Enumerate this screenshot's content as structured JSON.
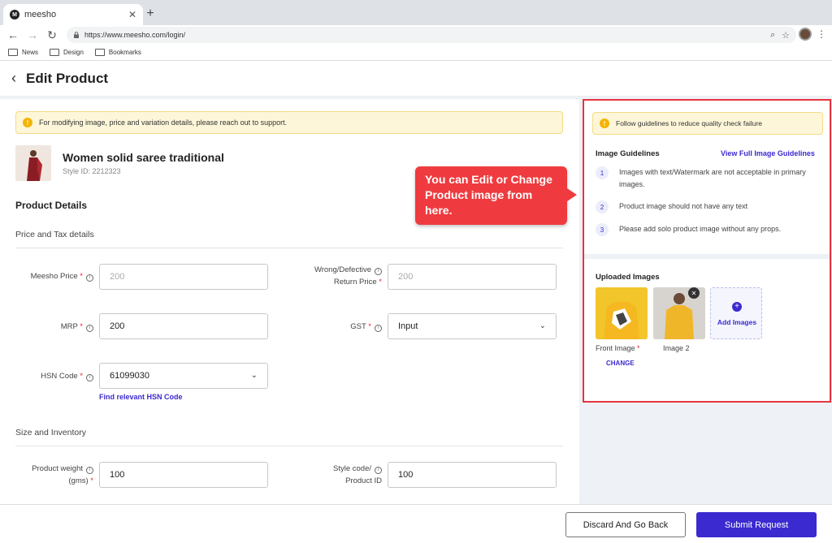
{
  "browser": {
    "tab_title": "meesho",
    "favicon_letter": "M",
    "url": "https://www.meesho.com/login/",
    "bookmarks": [
      "News",
      "Design",
      "Bookmarks"
    ]
  },
  "header": {
    "title": "Edit Product"
  },
  "form": {
    "notice": "For modifying image, price and variation details, please reach out to support.",
    "product_name": "Women solid saree traditional",
    "style_id": "Style ID: 2212323",
    "section_title": "Product Details",
    "price_tax_title": "Price and Tax details",
    "meesho_price_label": "Meesho Price",
    "meesho_price_value": "200",
    "return_price_label_1": "Wrong/Defective",
    "return_price_label_2": "Return Price",
    "return_price_value": "200",
    "mrp_label": "MRP",
    "mrp_value": "200",
    "gst_label": "GST",
    "gst_value": "Input",
    "hsn_label": "HSN Code",
    "hsn_value": "61099030",
    "hsn_link": "Find relevant HSN Code",
    "size_inventory_title": "Size and Inventory",
    "weight_label_1": "Product weight",
    "weight_label_2": "(gms)",
    "weight_value": "100",
    "style_code_label_1": "Style code/",
    "style_code_label_2": "Product ID",
    "style_code_value": "100"
  },
  "guidelines": {
    "notice": "Follow guidelines to reduce quality check failure",
    "title": "Image Guidelines",
    "link": "View Full Image Guidelines",
    "items": [
      {
        "num": "1",
        "text": "Images with text/Watermark are not acceptable in primary images."
      },
      {
        "num": "2",
        "text": "Product image should not have any text"
      },
      {
        "num": "3",
        "text": "Please add solo product image without any props."
      }
    ],
    "uploaded_title": "Uploaded Images",
    "front_image_label": "Front Image",
    "image2_label": "Image 2",
    "add_images_label": "Add Images",
    "change_label": "CHANGE"
  },
  "callout": {
    "text": "You can Edit or Change Product image from here."
  },
  "footer": {
    "discard_label": "Discard And Go Back",
    "submit_label": "Submit Request"
  },
  "colors": {
    "brand_purple": "#3b2ad0",
    "highlight_red": "#e8333f",
    "notice_yellow": "#fdf6d8"
  }
}
